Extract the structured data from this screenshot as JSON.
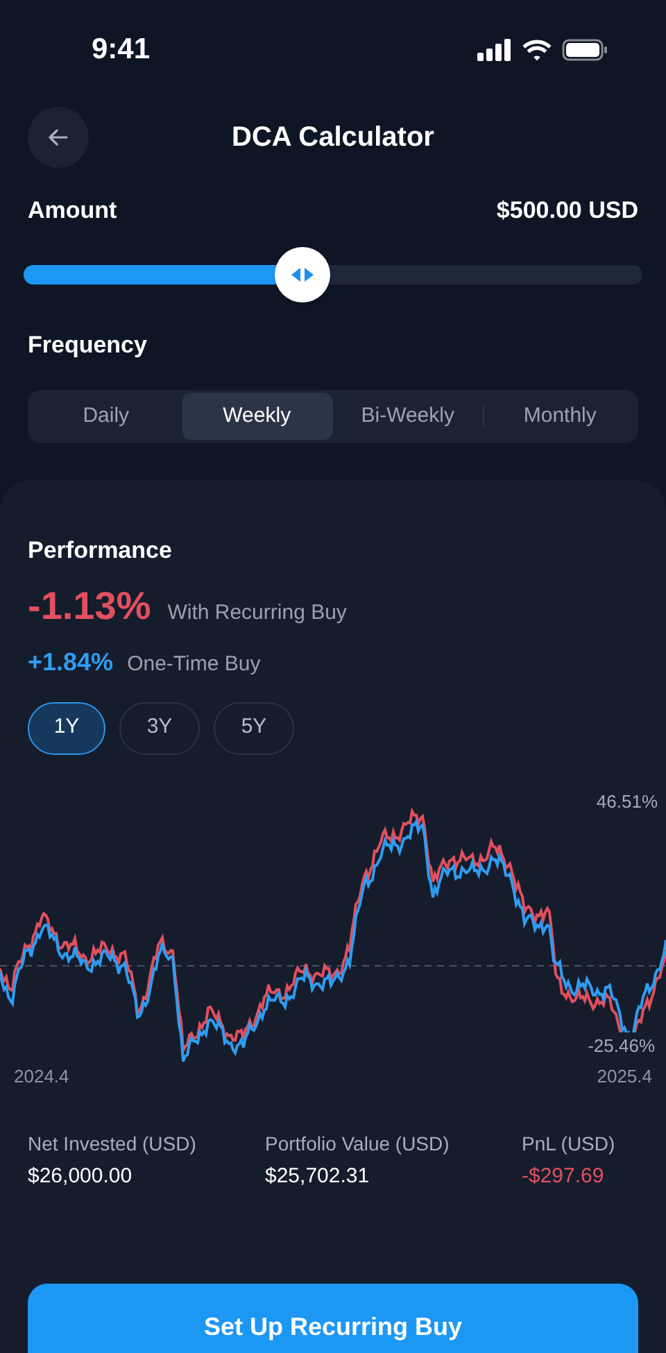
{
  "status_bar": {
    "time": "9:41"
  },
  "header": {
    "title": "DCA Calculator"
  },
  "amount": {
    "label": "Amount",
    "value": "$500.00 USD",
    "level": 0.45
  },
  "frequency": {
    "label": "Frequency",
    "options": [
      {
        "label": "Daily",
        "selected": false
      },
      {
        "label": "Weekly",
        "selected": true
      },
      {
        "label": "Bi-Weekly",
        "selected": false
      },
      {
        "label": "Monthly",
        "selected": false
      }
    ]
  },
  "performance": {
    "title": "Performance",
    "results": [
      {
        "kind": "primary",
        "value": "-1.13%",
        "label": "With Recurring Buy",
        "color": "#e2505f"
      },
      {
        "kind": "secondary",
        "value": "+1.84%",
        "label": "One-Time Buy",
        "color": "#2f9cf0"
      }
    ],
    "periods": [
      {
        "label": "1Y",
        "selected": true
      },
      {
        "label": "3Y",
        "selected": false
      },
      {
        "label": "5Y",
        "selected": false
      }
    ],
    "chart": {
      "max_label": "46.51%",
      "min_label": "-25.46%",
      "start_label": "2024.4",
      "end_label": "2025.4"
    },
    "stats": [
      {
        "label": "Net Invested (USD)",
        "value": "$26,000.00",
        "kind": "plain"
      },
      {
        "label": "Portfolio Value (USD)",
        "value": "$25,702.31",
        "kind": "plain"
      },
      {
        "label": "PnL (USD)",
        "value": "-$297.69",
        "kind": "loss"
      }
    ]
  },
  "primary_button": {
    "label": "Set Up Recurring Buy"
  }
}
